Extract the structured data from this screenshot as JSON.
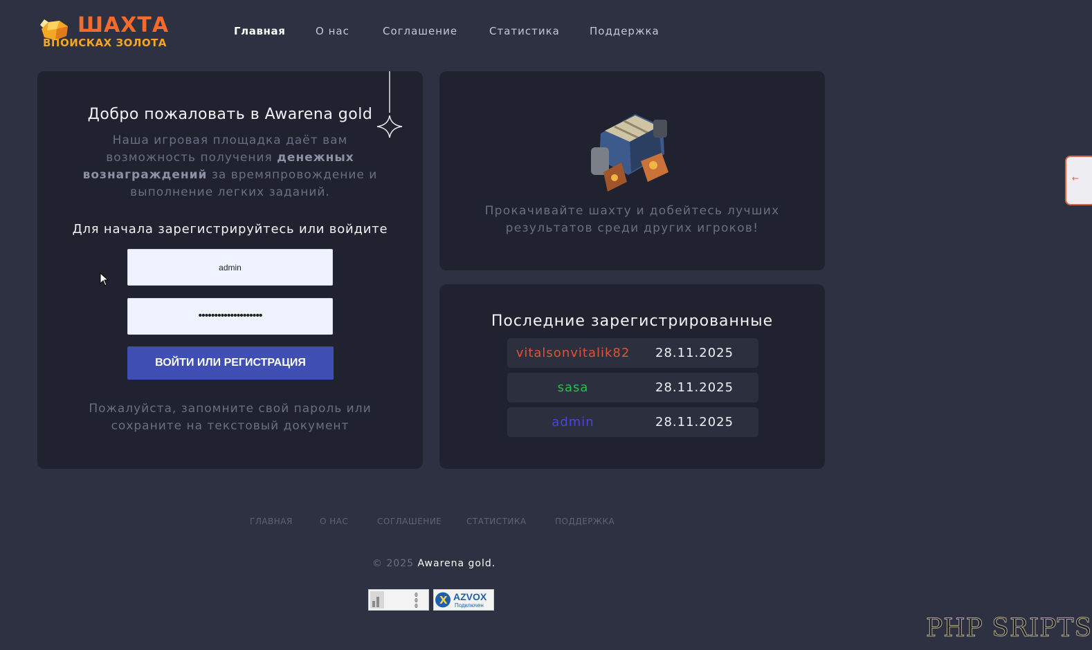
{
  "brand": {
    "logo_line1": "ШАХТА",
    "logo_line2": "ВПОИСКАХ ЗОЛОТА",
    "logo_alt": "gold-nugget-logo"
  },
  "nav": [
    {
      "label": "Главная",
      "active": true
    },
    {
      "label": "О нас"
    },
    {
      "label": "Соглашение"
    },
    {
      "label": "Статистика"
    },
    {
      "label": "Поддержка"
    }
  ],
  "welcome": {
    "title": "Добро пожаловать в Awarena gold",
    "text_before": "Наша игровая площадка даёт вам возможность получения ",
    "text_bold": "денежных вознаграждений",
    "text_after": " за времяпровождение и выполнение легких заданий.",
    "register_prompt": "Для начала зарегистрируйтесь или войдите",
    "login_value": "admin",
    "password_value": "••••••••••••••••••••",
    "submit_label": "ВОЙТИ ИЛИ РЕГИСТРАЦИЯ",
    "note": "Пожалуйста, запомните свой пароль или сохраните на текстовый документ"
  },
  "mine": {
    "text": "Прокачивайте шахту и добейтесь лучших результатов среди других игроков!"
  },
  "latest": {
    "title": "Последние зарегистрированные",
    "users": [
      {
        "name": "vitalsonvitalik82",
        "date": "28.11.2025",
        "color": "#e0533a"
      },
      {
        "name": "sasa",
        "date": "28.11.2025",
        "color": "#27c04a"
      },
      {
        "name": "admin",
        "date": "28.11.2025",
        "color": "#4b45e0"
      }
    ]
  },
  "footer": {
    "nav": [
      "ГЛАВНАЯ",
      "О НАС",
      "СОГЛАШЕНИЕ",
      "СТАТИСТИКА",
      "ПОДДЕРЖКА"
    ],
    "copyright_prefix": "© 2025 ",
    "copyright_brand": "Awarena gold.",
    "badge2_text": "AZVOX",
    "badge2_sub": "Подключен"
  },
  "side_tab": {
    "icon": "arrow-left-icon",
    "glyph": "←"
  },
  "watermark": "PHP SRIPTS",
  "colors": {
    "bg": "#2d3142",
    "panel": "#20232f",
    "accent": "#3f4fb3",
    "logo": "#f46b2c"
  }
}
